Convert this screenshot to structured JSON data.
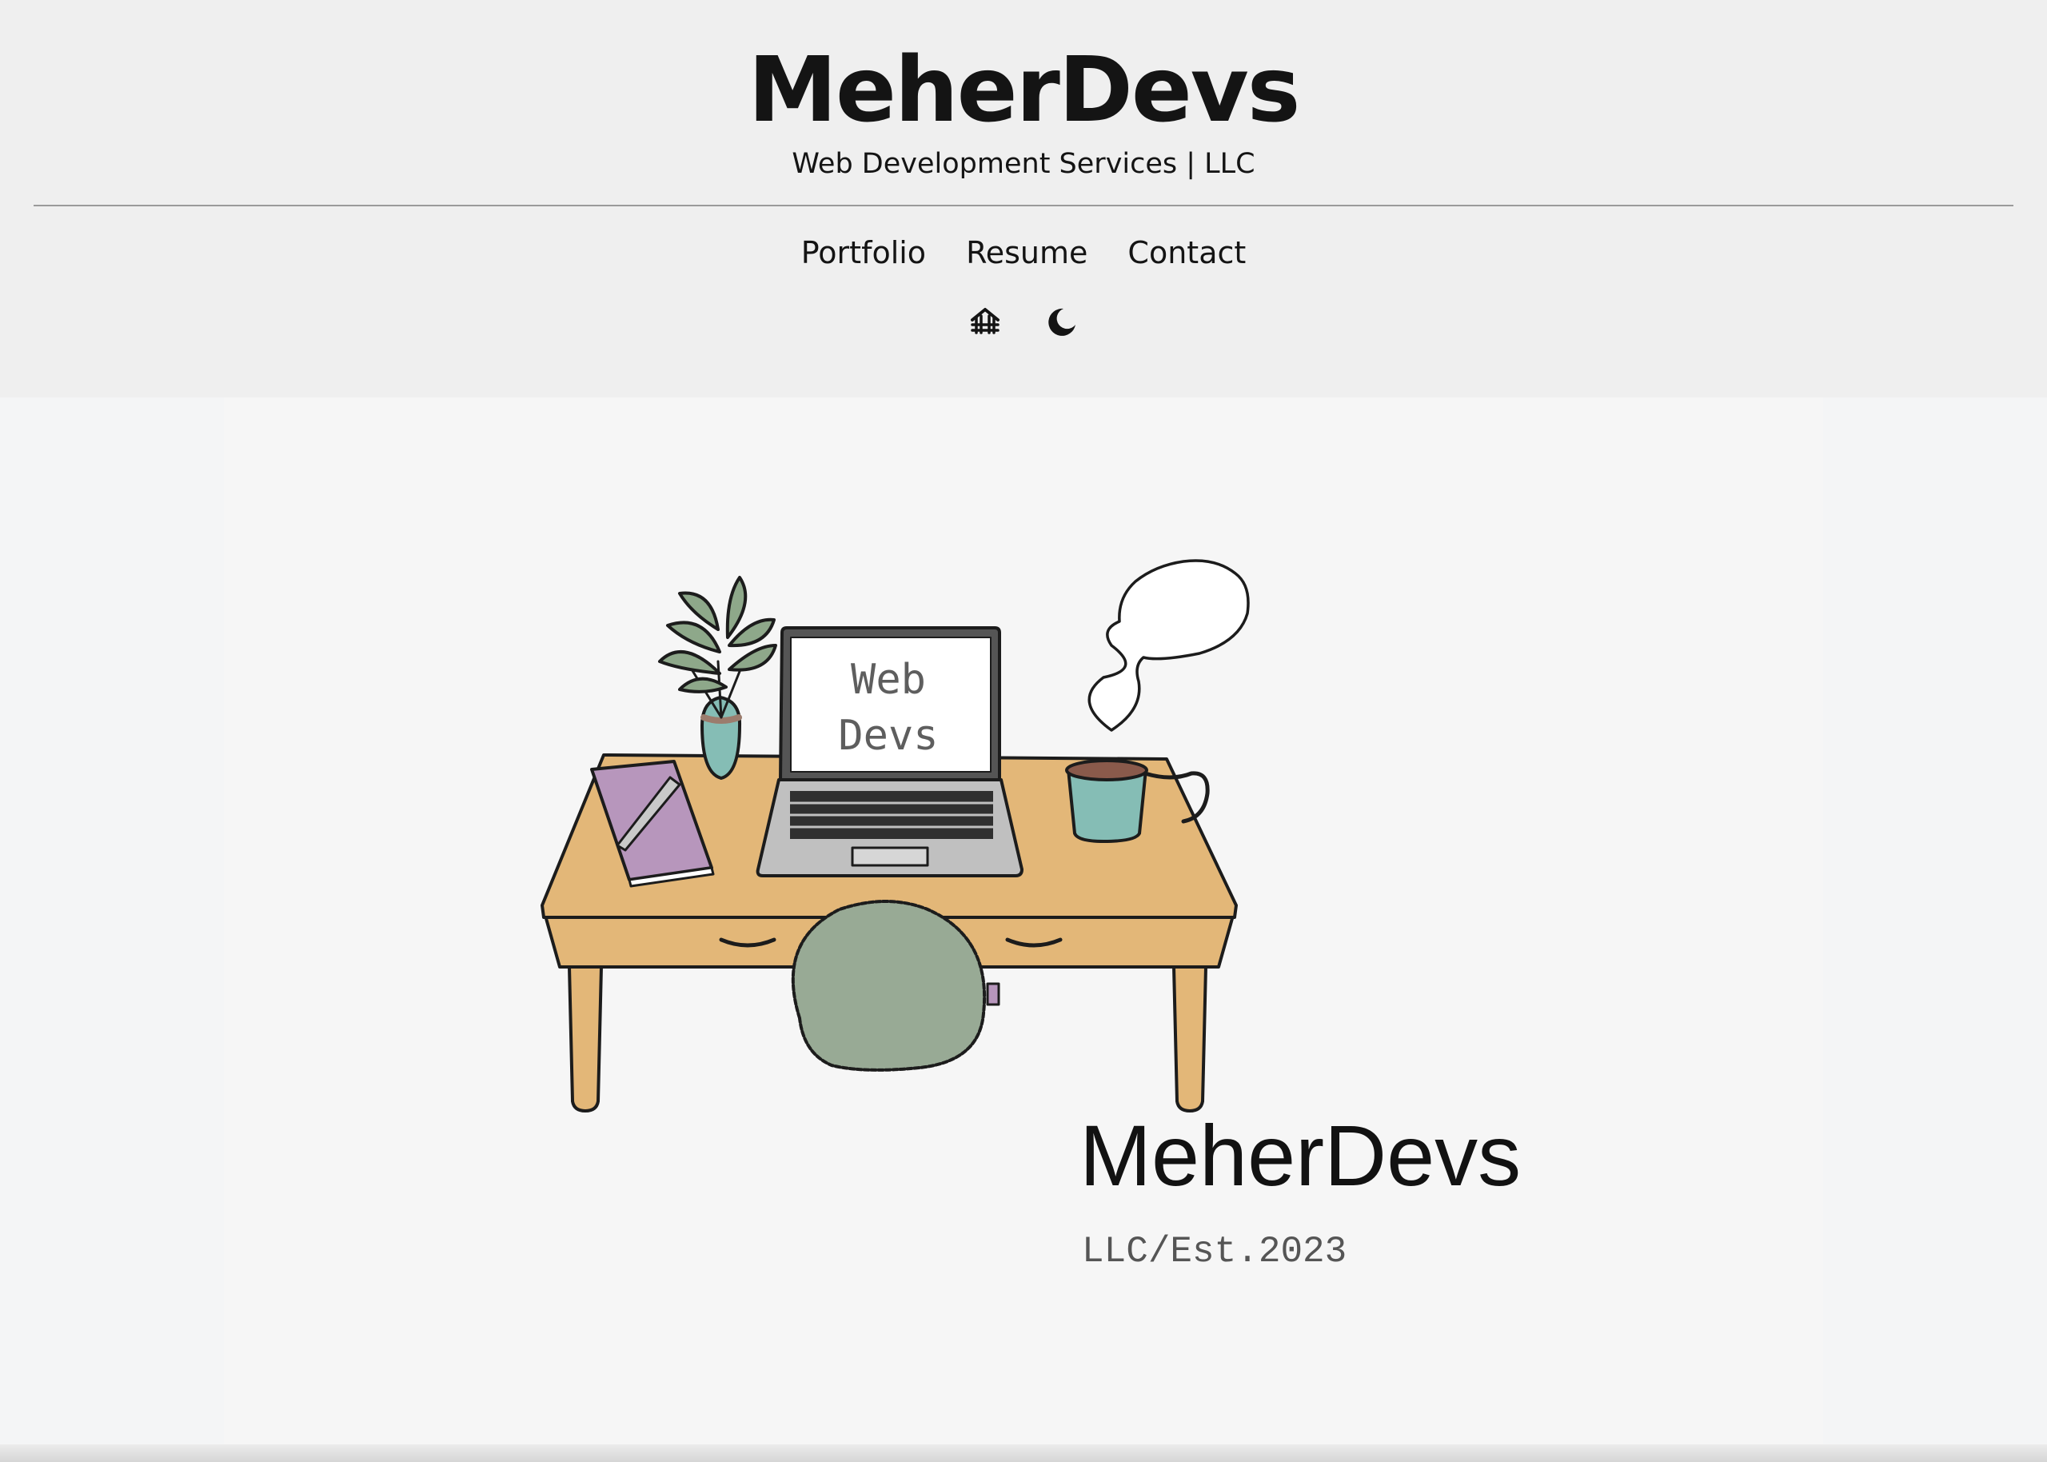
{
  "header": {
    "title": "MeherDevs",
    "subtitle": "Web Development Services | LLC"
  },
  "nav": {
    "items": [
      {
        "label": "Portfolio"
      },
      {
        "label": "Resume"
      },
      {
        "label": "Contact"
      }
    ]
  },
  "toolbar": {
    "icons": [
      "house-icon",
      "moon-icon"
    ]
  },
  "hero": {
    "laptop_screen_line1": "Web",
    "laptop_screen_line2": "Devs",
    "logo_name": "MeherDevs",
    "logo_tagline": "LLC/Est.2023"
  },
  "colors": {
    "header_bg": "#efefef",
    "page_bg": "#f4f5f6",
    "desk": "#e3b778",
    "plant_leaf": "#8ea88a",
    "pot": "#85bdb5",
    "notebook": "#b796bc",
    "cushion": "#98aa95",
    "laptop": "#c0c0c0"
  }
}
